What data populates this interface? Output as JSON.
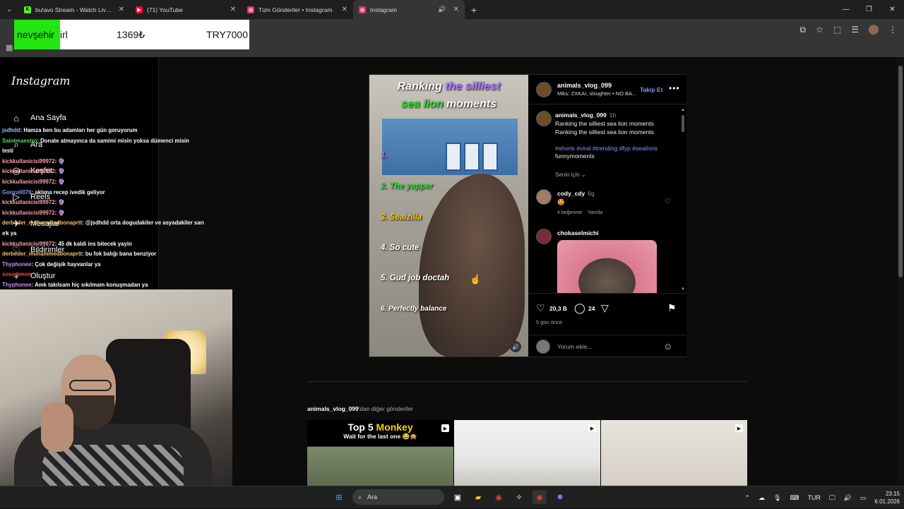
{
  "browser": {
    "tabs": [
      {
        "title": "bu!avo Stream - Watch Live on",
        "icon": "kick-icon",
        "color": "#53fc18",
        "glyph": "K"
      },
      {
        "title": "(71) YouTube",
        "icon": "youtube-icon",
        "color": "#ff0033",
        "glyph": "▶"
      },
      {
        "title": "Tüm Gönderiler • Instagram",
        "icon": "instagram-icon",
        "color": "#e1306c",
        "glyph": "◎"
      },
      {
        "title": "Instagram",
        "icon": "instagram-icon",
        "color": "#e1306c",
        "glyph": "◎"
      }
    ]
  },
  "overlay": {
    "name1": "nevşehir",
    "name2": "irl",
    "price": "1369₺",
    "target": "TRY7000"
  },
  "sidebar": {
    "logo": "Instagram",
    "nav": [
      {
        "label": "Ana Sayfa",
        "icon": "home-icon",
        "glyph": "⌂"
      },
      {
        "label": "Ara",
        "icon": "search-icon",
        "glyph": "⌕"
      },
      {
        "label": "Keşfet",
        "icon": "compass-icon",
        "glyph": "◎"
      },
      {
        "label": "Reels",
        "icon": "reels-icon",
        "glyph": "▷"
      },
      {
        "label": "Mesajlar",
        "icon": "messages-icon",
        "glyph": "✈"
      },
      {
        "label": "Bildirimler",
        "icon": "heart-icon",
        "glyph": "♡"
      },
      {
        "label": "Oluştur",
        "icon": "plus-icon",
        "glyph": "+"
      }
    ]
  },
  "chat": [
    {
      "user": "jsdhdd",
      "ucolor": "#8cc8ff",
      "msg": ": Hamza ben bu adamları her gün goruyorum"
    },
    {
      "user": "Saintmaestro",
      "ucolor": "#59d96b",
      "msg": ": Donate atmayınca da samimi misin yoksa dümenci misin"
    },
    {
      "user": "",
      "ucolor": "#fff",
      "msg": "testi"
    },
    {
      "user": "kickkullanicisi99972",
      "ucolor": "#ff9fb0",
      "msg": ": 🔮"
    },
    {
      "user": "kickkullanicisi99972",
      "ucolor": "#ff9fb0",
      "msg": ": 🔮"
    },
    {
      "user": "kickkullanicisi99972",
      "ucolor": "#ff9fb0",
      "msg": ": 🔮"
    },
    {
      "user": "Gonzo0076",
      "ucolor": "#7f9cff",
      "msg": ": aklıma recep ivedik geliyor"
    },
    {
      "user": "kickkullanicisi99972",
      "ucolor": "#ff9fb0",
      "msg": ": 🔮"
    },
    {
      "user": "kickkullanicisi99972",
      "ucolor": "#ff9fb0",
      "msg": ": 🔮"
    },
    {
      "user": "derbeder_muhammedbonaprtt",
      "ucolor": "#f3c26b",
      "msg": ": @jsdhdd orta dogudakiler ve asyadakiler sarı"
    },
    {
      "user": "",
      "ucolor": "#fff",
      "msg": "ırk ya"
    },
    {
      "user": "kickkullanicisi99972",
      "ucolor": "#ff9fb0",
      "msg": ": 45 dk kaldi ins bitecek yayin"
    },
    {
      "user": "derbeder_muhammedbonaprtt",
      "ucolor": "#f3c26b",
      "msg": ": bu fok balığı bana benziyor"
    },
    {
      "user": "Thyphonee",
      "ucolor": "#c88cff",
      "msg": ": Çok değişik hayvanlar ya"
    },
    {
      "user": "sosodeeon",
      "ucolor": "#ff4444",
      "msg": ""
    },
    {
      "user": "Thyphonee",
      "ucolor": "#c88cff",
      "msg": ": Amk takılsam hiç sıkılmam konuşmadan ya"
    }
  ],
  "post": {
    "video": {
      "title_a": "Ranking ",
      "title_b": "the silliest",
      "title_c": "sea lion",
      "title_d": " moments",
      "ranks": [
        "1.",
        "2. The yapper",
        "3. Seaizilla",
        "4. So cute",
        "5. Gud job doctah",
        "6. Perfectly balance"
      ]
    },
    "author": "animals_vlog_099",
    "music": "Miks: ZXKAI, slxughter • NO BA...",
    "follow_label": "Takip Et",
    "caption": {
      "user": "animals_vlog_099",
      "time": "1h",
      "line1": "Ranking the silliest sea lion moments",
      "line2": "Ranking the silliest sea lion moments",
      "tags": "#shorts #viral #trending #fyp #sealions",
      "tail": "funnymoments"
    },
    "for_you": "Senin için",
    "comments": [
      {
        "user": "cody_cdy",
        "time": "6g",
        "text": "🤩",
        "likes": "4 beğenme",
        "reply": "Yanıtla"
      },
      {
        "user": "chokaselmichi",
        "time": "",
        "text": "",
        "likes": "",
        "reply": ""
      }
    ],
    "likes_count": "20,3 B",
    "comments_count": "24",
    "date": "5 gün önce",
    "add_comment": "Yorum ekle..."
  },
  "more": {
    "author": "animals_vlog_099",
    "suffix": "'dan diğer gönderiler",
    "thumb1_a": "Top 5 ",
    "thumb1_b": "Monkey",
    "thumb1_sub": "Wait for the last one 😂🙊"
  },
  "taskbar": {
    "search": "Ara",
    "lang": "TUR",
    "time": "23:15",
    "date": "6.01.2026"
  }
}
